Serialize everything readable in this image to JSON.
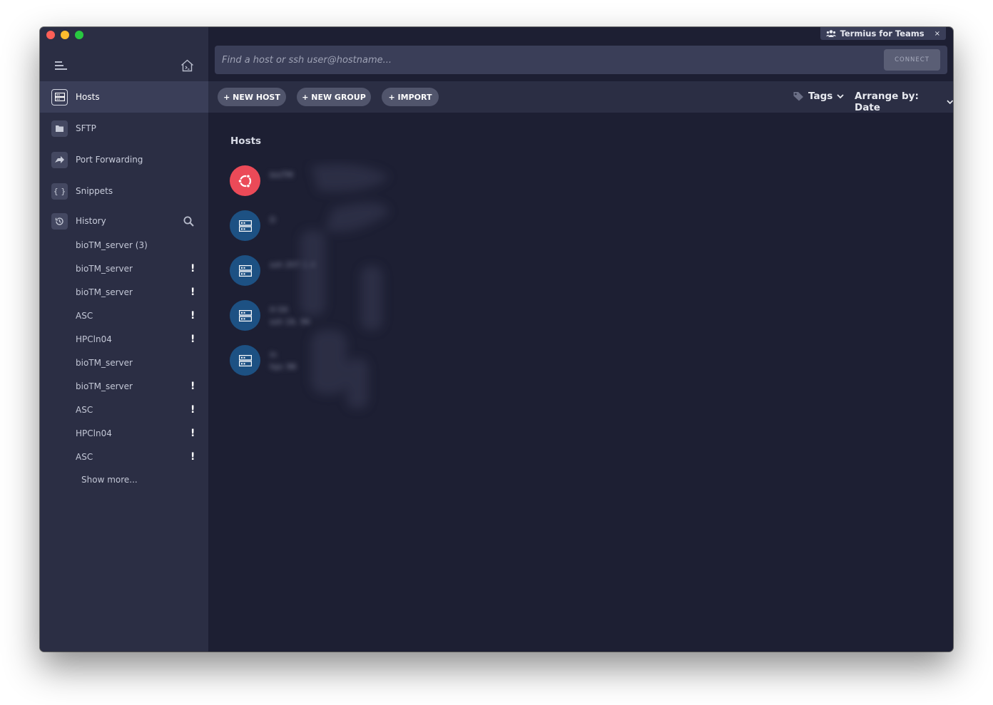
{
  "window": {
    "colors": {
      "sidebar": "#2b2e44",
      "main": "#1d1f33",
      "accent_red": "#eb4a58",
      "accent_blue": "#1d5183"
    }
  },
  "sidebar": {
    "nav": [
      {
        "label": "Hosts",
        "icon": "hosts-icon",
        "active": true
      },
      {
        "label": "SFTP",
        "icon": "folder-icon"
      },
      {
        "label": "Port Forwarding",
        "icon": "port-forward-icon"
      },
      {
        "label": "Snippets",
        "icon": "braces-icon"
      },
      {
        "label": "History",
        "icon": "history-icon"
      }
    ],
    "history": [
      {
        "label": "bioTM_server (3)",
        "warn": false
      },
      {
        "label": "bioTM_server",
        "warn": true
      },
      {
        "label": "bioTM_server",
        "warn": true
      },
      {
        "label": "ASC",
        "warn": true
      },
      {
        "label": "HPCln04",
        "warn": true
      },
      {
        "label": "bioTM_server",
        "warn": false
      },
      {
        "label": "bioTM_server",
        "warn": true
      },
      {
        "label": "ASC",
        "warn": true
      },
      {
        "label": "HPCln04",
        "warn": true
      },
      {
        "label": "ASC",
        "warn": true
      }
    ],
    "warn_mark": "!",
    "show_more": "Show more..."
  },
  "header": {
    "teams_badge": "Termius for Teams",
    "teams_close": "×",
    "search_placeholder": "Find a host or ssh user@hostname...",
    "connect_label": "CONNECT"
  },
  "toolbar": {
    "new_host": "+ NEW HOST",
    "new_group": "+ NEW GROUP",
    "import": "+ IMPORT",
    "tags": "Tags",
    "arrange": "Arrange by: Date"
  },
  "hosts": {
    "title": "Hosts",
    "items": [
      {
        "name": "bioTM",
        "detail": "",
        "icon": "ubuntu-icon"
      },
      {
        "name": "D",
        "detail": "",
        "icon": "server-icon"
      },
      {
        "name": "",
        "detail": "ssh 207.1.4",
        "icon": "server-icon"
      },
      {
        "name": "H 04",
        "detail": "ssh 16. 96",
        "icon": "server-icon"
      },
      {
        "name": "in",
        "detail": "hpc 96",
        "icon": "server-icon"
      }
    ]
  }
}
